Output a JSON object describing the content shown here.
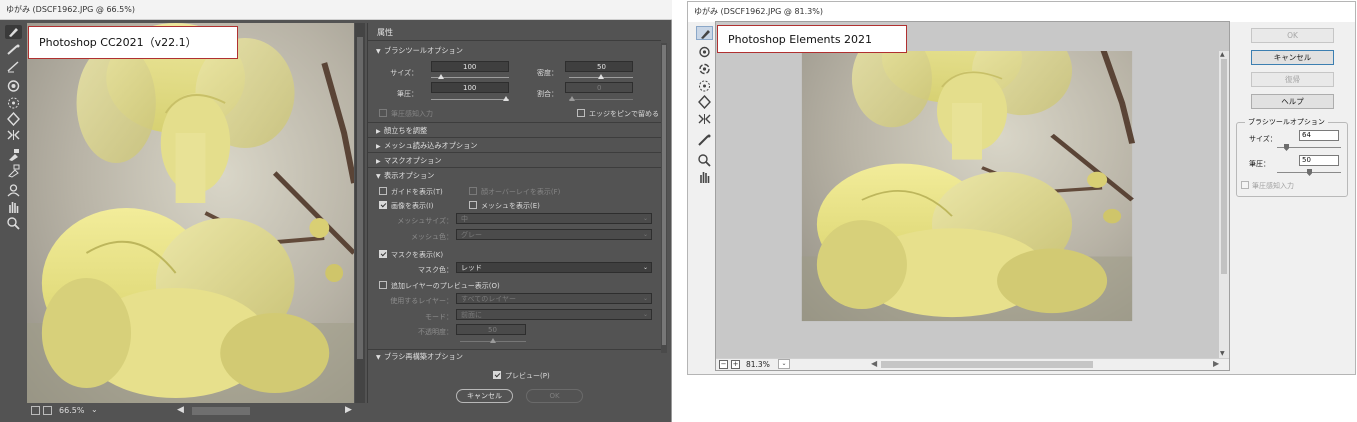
{
  "left_window": {
    "title": "ゆがみ (DSCF1962.JPG @ 66.5%)",
    "label": "Photoshop CC2021（v22.1）",
    "zoom": "66.5%",
    "zoom_dropdown": "⌄",
    "tools": [
      "forward-warp-tool",
      "reconstruct-tool",
      "smooth-tool",
      "twirl-clockwise-tool",
      "pucker-tool",
      "bloat-tool",
      "push-left-tool",
      "freeze-mask-tool",
      "thaw-mask-tool",
      "face-tool",
      "hand-tool",
      "zoom-tool"
    ],
    "panel": {
      "title": "属性",
      "brush_section": "ブラシツールオプション",
      "size_label": "サイズ：",
      "size_value": "100",
      "size_level": 0.1,
      "density_label": "密度：",
      "density_value": "50",
      "density_level": 0.5,
      "pressure_label": "筆圧：",
      "pressure_value": "100",
      "pressure_level": 1.0,
      "rate_label": "割合：",
      "rate_value": "0",
      "rate_level": 0.0,
      "stylus_label": "筆圧感知入力",
      "pin_edges_label": "エッジをピンで留める",
      "face_section": "顔立ちを調整",
      "mesh_load_section": "メッシュ読み込みオプション",
      "mask_section": "マスクオプション",
      "view_section": "表示オプション",
      "guides_label": "ガイドを表示(T)",
      "face_overlay_label": "顔オーバーレイを表示(F)",
      "image_label": "画像を表示(I)",
      "mesh_label": "メッシュを表示(E)",
      "mesh_size_label": "メッシュサイズ：",
      "mesh_size_value": "中",
      "mesh_color_label": "メッシュ色：",
      "mesh_color_value": "グレー",
      "show_mask_label": "マスクを表示(K)",
      "mask_color_label": "マスク色：",
      "mask_color_value": "レッド",
      "backdrop_label": "追加レイヤーのプレビュー表示(O)",
      "use_layer_label": "使用するレイヤー：",
      "use_layer_value": "すべてのレイヤー",
      "mode_label": "モード：",
      "mode_value": "前面に",
      "opacity_label": "不透明度：",
      "opacity_value": "50",
      "opacity_level": 0.5,
      "brush_recon_section": "ブラシ再構築オプション",
      "preview_label": "プレビュー(P)",
      "cancel_label": "キャンセル",
      "ok_label": "OK"
    }
  },
  "right_window": {
    "title": "ゆがみ (DSCF1962.JPG @ 81.3%)",
    "label": "Photoshop Elements 2021",
    "zoom": "81.3%",
    "zoom_dropdown": "⌄",
    "tools": [
      "warp-tool",
      "twirl-clockwise-tool",
      "twirl-counterclockwise-tool",
      "pucker-tool",
      "bloat-tool",
      "shift-pixels-tool",
      "reflection-tool",
      "reconstruct-tool",
      "zoom-tool",
      "hand-tool"
    ],
    "buttons": {
      "ok": "OK",
      "cancel": "キャンセル",
      "revert": "復帰",
      "help": "ヘルプ"
    },
    "brush_group_title": "ブラシツールオプション",
    "size_label": "サイズ：",
    "size_value": "64",
    "size_level": 0.12,
    "pressure_label": "筆圧：",
    "pressure_value": "50",
    "pressure_level": 0.5,
    "stylus_label": "筆圧感知入力"
  }
}
